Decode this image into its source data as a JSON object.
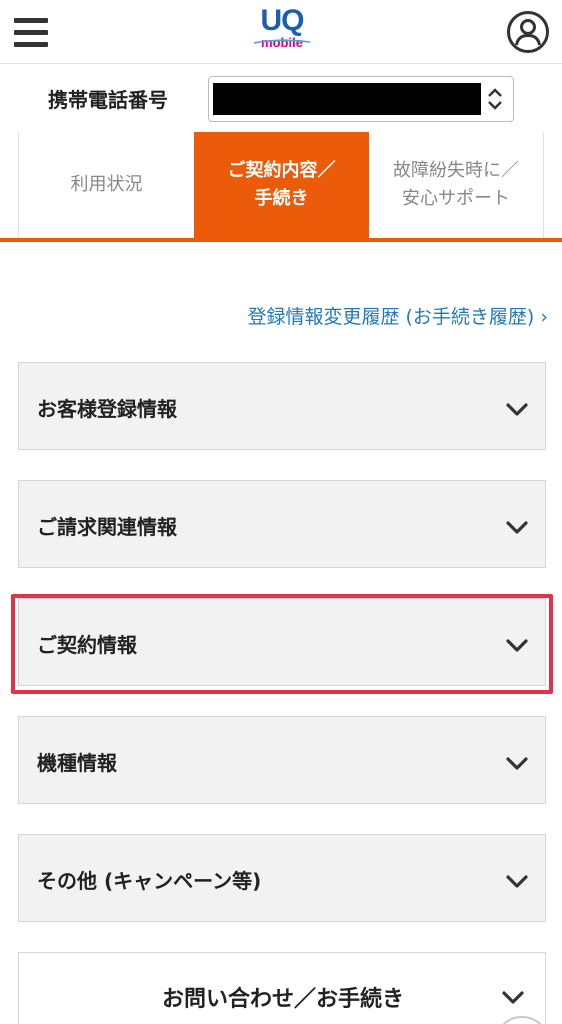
{
  "header": {
    "logo_main": "UQ",
    "logo_sub": "mobile",
    "menu_icon": "hamburger-menu-icon",
    "account_icon": "user-account-icon"
  },
  "phone": {
    "label": "携帯電話番号",
    "select_arrow_icon": "updown-arrow-icon"
  },
  "tabs": [
    {
      "label": "利用状況"
    },
    {
      "label_line1": "ご契約内容／",
      "label_line2": "手続き"
    },
    {
      "label_line1": "故障紛失時に／",
      "label_line2": "安心サポート"
    }
  ],
  "history_link": "登録情報変更履歴 (お手続き履歴) ›",
  "accordion": [
    {
      "label": "お客様登録情報"
    },
    {
      "label": "ご請求関連情報"
    },
    {
      "label": "ご契約情報"
    },
    {
      "label": "機種情報"
    },
    {
      "label": "その他 (キャンペーン等)"
    }
  ],
  "contact": {
    "label": "お問い合わせ／お手続き"
  },
  "colors": {
    "accent": "#eb5b0a",
    "link": "#2578b5",
    "highlight": "#e0334a",
    "logo_blue": "#1b5fae",
    "logo_pink": "#e4007f"
  }
}
